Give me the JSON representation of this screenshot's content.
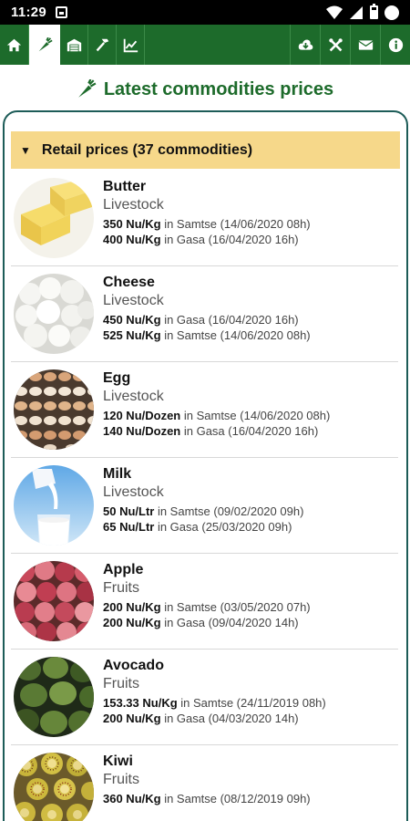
{
  "status_bar": {
    "time": "11:29"
  },
  "title": "Latest commodities prices",
  "section": {
    "label": "Retail prices (37 commodities)"
  },
  "colors": {
    "brand_green": "#1d6b2b",
    "header_yellow": "#f6d88a",
    "card_border": "#1d5c58"
  },
  "toolbar": {
    "left_icons": [
      "home-icon",
      "commodities-icon",
      "market-icon",
      "tools-icon",
      "chart-icon"
    ],
    "right_icons": [
      "cloud-download-icon",
      "settings-tools-icon",
      "mail-icon",
      "info-icon"
    ]
  },
  "commodities": [
    {
      "name": "Butter",
      "category": "Livestock",
      "prices": [
        {
          "value": "350 Nu/Kg",
          "location": " in Samtse (14/06/2020 08h)"
        },
        {
          "value": "400 Nu/Kg",
          "location": " in Gasa (16/04/2020 16h)"
        }
      ]
    },
    {
      "name": "Cheese",
      "category": "Livestock",
      "prices": [
        {
          "value": "450 Nu/Kg",
          "location": " in Gasa (16/04/2020 16h)"
        },
        {
          "value": "525 Nu/Kg",
          "location": " in Samtse (14/06/2020 08h)"
        }
      ]
    },
    {
      "name": "Egg",
      "category": "Livestock",
      "prices": [
        {
          "value": "120 Nu/Dozen",
          "location": " in Samtse (14/06/2020 08h)"
        },
        {
          "value": "140 Nu/Dozen",
          "location": " in Gasa (16/04/2020 16h)"
        }
      ]
    },
    {
      "name": "Milk",
      "category": "Livestock",
      "prices": [
        {
          "value": "50 Nu/Ltr",
          "location": " in Samtse (09/02/2020 09h)"
        },
        {
          "value": "65 Nu/Ltr",
          "location": " in Gasa (25/03/2020 09h)"
        }
      ]
    },
    {
      "name": "Apple",
      "category": "Fruits",
      "prices": [
        {
          "value": "200 Nu/Kg",
          "location": " in Samtse (03/05/2020 07h)"
        },
        {
          "value": "200 Nu/Kg",
          "location": " in Gasa (09/04/2020 14h)"
        }
      ]
    },
    {
      "name": "Avocado",
      "category": "Fruits",
      "prices": [
        {
          "value": "153.33 Nu/Kg",
          "location": " in Samtse (24/11/2019 08h)"
        },
        {
          "value": "200 Nu/Kg",
          "location": " in Gasa (04/03/2020 14h)"
        }
      ]
    },
    {
      "name": "Kiwi",
      "category": "Fruits",
      "prices": [
        {
          "value": "360 Nu/Kg",
          "location": " in Samtse (08/12/2019 09h)"
        }
      ]
    }
  ]
}
